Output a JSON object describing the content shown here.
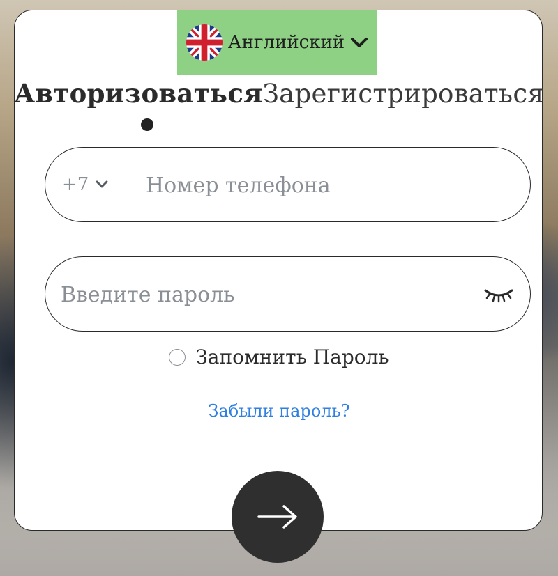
{
  "language": {
    "label": "Английский",
    "flag_icon": "uk-flag-icon",
    "chevron_icon": "chevron-down-icon",
    "background": "#8ed185"
  },
  "tabs": {
    "login": "Авторизоваться",
    "register": "Зарегистрироваться",
    "active": "login"
  },
  "phone": {
    "country_code": "+7",
    "placeholder": "Номер телефона",
    "value": ""
  },
  "password": {
    "placeholder": "Введите пароль",
    "value": "",
    "toggle_icon": "eye-closed-icon"
  },
  "remember": {
    "label": "Запомнить Пароль",
    "checked": false
  },
  "forgot": {
    "label": "Забыли пароль?",
    "color": "#2f7fe0"
  },
  "submit": {
    "icon": "arrow-right-icon",
    "background": "#2f2f2f"
  }
}
